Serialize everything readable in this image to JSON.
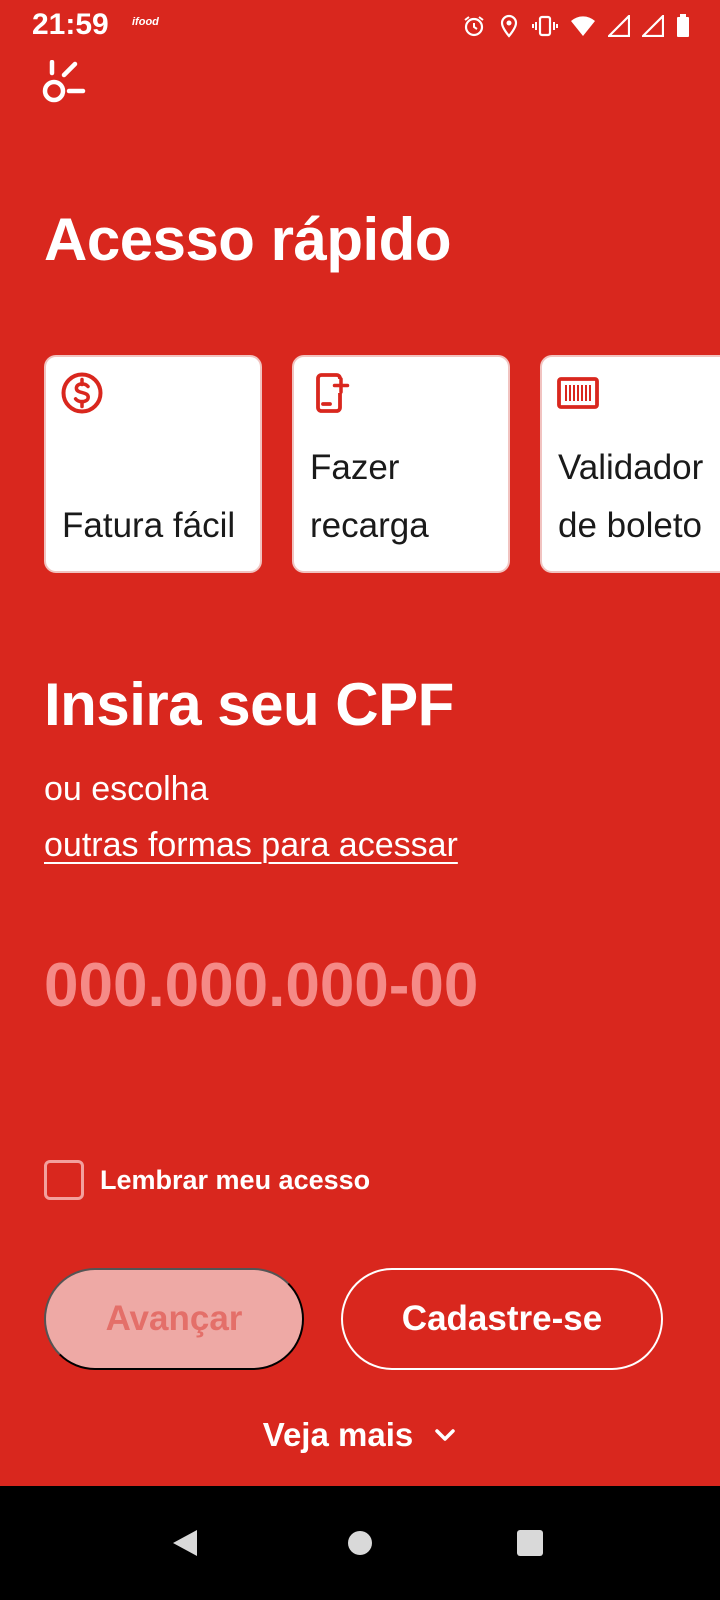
{
  "status_bar": {
    "time": "21:59",
    "app_indicator": "ifood",
    "icons": [
      "alarm-icon",
      "location-icon",
      "vibrate-icon",
      "wifi-icon",
      "signal-icon",
      "signal-icon",
      "battery-icon"
    ]
  },
  "app": {
    "logo_icon": "app-logo-icon"
  },
  "quick_access": {
    "title": "Acesso rápido",
    "cards": [
      {
        "label": "Fatura fácil",
        "icon": "dollar-circle-icon"
      },
      {
        "label": "Fazer\nrecarga",
        "icon": "phone-add-icon"
      },
      {
        "label": "Validador\nde boleto",
        "icon": "barcode-icon"
      }
    ]
  },
  "login": {
    "title": "Insira seu CPF",
    "subtitle": "ou escolha",
    "alt_link": "outras formas para acessar",
    "cpf_placeholder": "000.000.000-00",
    "cpf_value": "",
    "remember_label": "Lembrar meu acesso",
    "remember_checked": false,
    "next_label": "Avançar",
    "signup_label": "Cadastre-se",
    "more_label": "Veja mais"
  },
  "colors": {
    "background": "#d9271e",
    "card_background": "#ffffff",
    "icon_color": "#d9271e",
    "placeholder": "#f58a87",
    "disabled_button": "#eea9a5"
  },
  "nav_bar": {
    "buttons": [
      "back-icon",
      "home-icon",
      "recent-apps-icon"
    ]
  }
}
